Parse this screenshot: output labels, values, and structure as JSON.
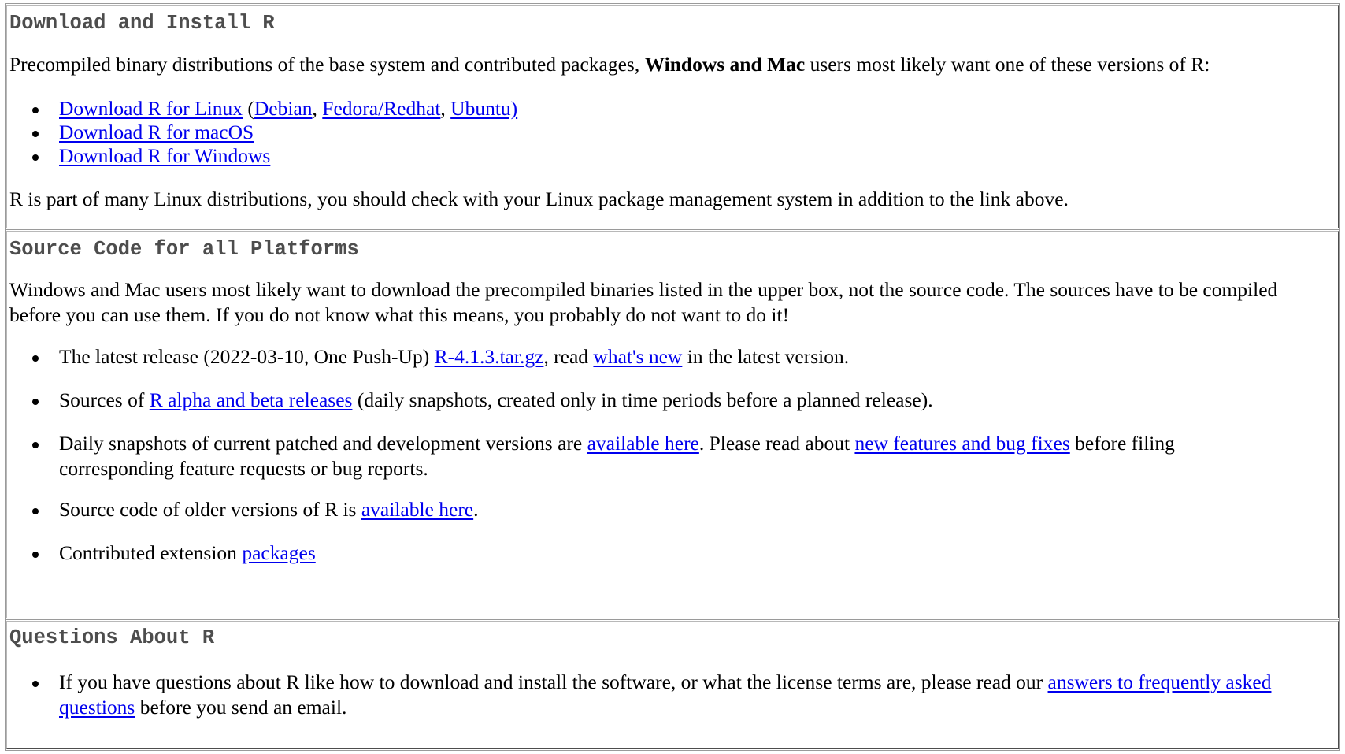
{
  "download_section": {
    "heading": "Download and Install R",
    "intro_before": "Precompiled binary distributions of the base system and contributed packages, ",
    "intro_bold": "Windows and Mac",
    "intro_after": " users most likely want one of these versions of R:",
    "links": {
      "linux": "Download R for Linux",
      "paren_open": " (",
      "debian": "Debian",
      "comma1": ", ",
      "fedora": "Fedora/Redhat",
      "comma2": ", ",
      "ubuntu": "Ubuntu)",
      "macos": "Download R for macOS",
      "windows": "Download R for Windows"
    },
    "footer": "R is part of many Linux distributions, you should check with your Linux package management system in addition to the link above."
  },
  "source_section": {
    "heading": "Source Code for all Platforms",
    "intro": "Windows and Mac users most likely want to download the precompiled binaries listed in the upper box, not the source code. The sources have to be compiled before you can use them. If you do not know what this means, you probably do not want to do it!",
    "items": [
      {
        "before": "The latest release (2022-03-10, One Push-Up) ",
        "link1": "R-4.1.3.tar.gz",
        "middle": ", read ",
        "link2": "what's new",
        "after": " in the latest version."
      },
      {
        "before": "Sources of ",
        "link1": "R alpha and beta releases",
        "after": " (daily snapshots, created only in time periods before a planned release)."
      },
      {
        "before": "Daily snapshots of current patched and development versions are ",
        "link1": "available here",
        "middle": ". Please read about ",
        "link2": "new features and bug fixes",
        "after": " before filing corresponding feature requests or bug reports."
      },
      {
        "before": "Source code of older versions of R is ",
        "link1": "available here",
        "after": "."
      },
      {
        "before": "Contributed extension ",
        "link1": "packages",
        "after": ""
      }
    ]
  },
  "questions_section": {
    "heading": "Questions About R",
    "item": {
      "before": "If you have questions about R like how to download and install the software, or what the license terms are, please read our ",
      "link1": "answers to frequently asked questions",
      "after": " before you send an email."
    }
  }
}
